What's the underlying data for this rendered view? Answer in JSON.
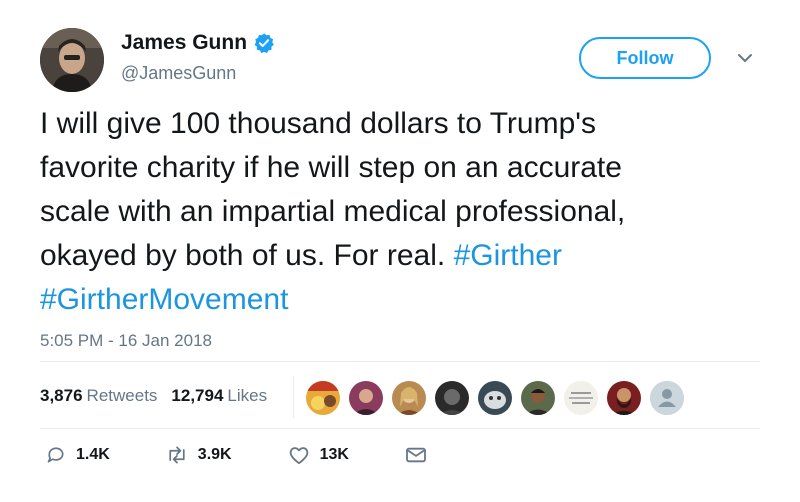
{
  "author": {
    "name": "James Gunn",
    "handle": "@JamesGunn",
    "verified": true
  },
  "follow_button": {
    "label": "Follow"
  },
  "tweet": {
    "lines": [
      "I will give 100 thousand dollars to Trump's",
      "favorite charity if he will step on an accurate",
      "scale with an impartial medical professional,",
      "okayed by both of us. For real. "
    ],
    "hashtags": [
      "#Girther",
      "#GirtherMovement"
    ],
    "timestamp": "5:05 PM - 16 Jan 2018"
  },
  "stats": {
    "retweets_count": "3,876",
    "retweets_label": "Retweets",
    "likes_count": "12,794",
    "likes_label": "Likes"
  },
  "actions": {
    "replies": "1.4K",
    "retweets": "3.9K",
    "likes": "13K"
  },
  "colors": {
    "accent": "#1da1f2",
    "hashtag": "#1b95e0",
    "muted": "#657786",
    "text": "#14171a"
  },
  "liker_avatars": [
    "comic-cover",
    "woman-portrait",
    "blonde-woman",
    "dark-portrait",
    "cat-photo",
    "man-portrait",
    "text-card",
    "bearded-man",
    "default-avatar"
  ]
}
